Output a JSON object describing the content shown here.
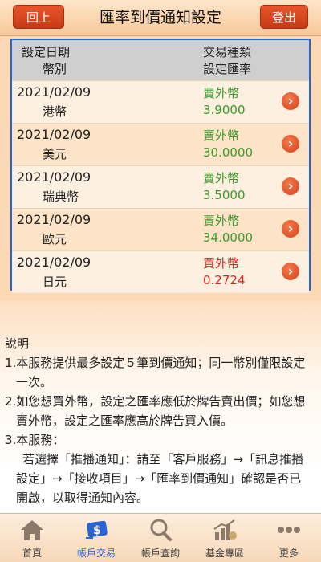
{
  "header": {
    "back_label": "回上頁",
    "title": "匯率到價通知設定",
    "logout_label": "登出"
  },
  "table": {
    "col_left_1": "設定日期",
    "col_left_2": "幣別",
    "col_right_1": "交易種類",
    "col_right_2": "設定匯率",
    "rows": [
      {
        "date": "2021/02/09",
        "currency": "港幣",
        "type": "賣外幣",
        "rate": "3.9000",
        "type_color": "#3a9b2a"
      },
      {
        "date": "2021/02/09",
        "currency": "美元",
        "type": "賣外幣",
        "rate": "30.0000",
        "type_color": "#3a9b2a"
      },
      {
        "date": "2021/02/09",
        "currency": "瑞典幣",
        "type": "賣外幣",
        "rate": "3.5000",
        "type_color": "#3a9b2a"
      },
      {
        "date": "2021/02/09",
        "currency": "歐元",
        "type": "賣外幣",
        "rate": "34.0000",
        "type_color": "#3a9b2a"
      },
      {
        "date": "2021/02/09",
        "currency": "日元",
        "type": "買外幣",
        "rate": "0.2724",
        "type_color": "#e02020"
      }
    ]
  },
  "notes": {
    "heading": "說明",
    "item1_a": "1.本服務提供最多設定５筆到價通知；同一幣別僅限設定",
    "item1_b": "一次。",
    "item2_a": "2.如您想買外幣，設定之匯率應低於牌告賣出價；如您想",
    "item2_b": "賣外幣，設定之匯率應高於牌告買入價。",
    "item3_a": "3.本服務：",
    "item3_b": "若選擇「推播通知」：請至「客戶服務」→「訊息推播",
    "item3_c": "設定」→「接收項目」→「匯率到價通知」確認是否已",
    "item3_d": "開啟，以取得通知內容。"
  },
  "tabbar": {
    "tabs": [
      {
        "label": "首頁",
        "icon": "home-icon"
      },
      {
        "label": "帳戶交易",
        "icon": "money-transfer-icon"
      },
      {
        "label": "帳戶查詢",
        "icon": "search-icon"
      },
      {
        "label": "基金專區",
        "icon": "fund-chart-icon"
      },
      {
        "label": "更多",
        "icon": "more-icon"
      }
    ],
    "active_index": 1,
    "active_color": "#2a63d6"
  }
}
